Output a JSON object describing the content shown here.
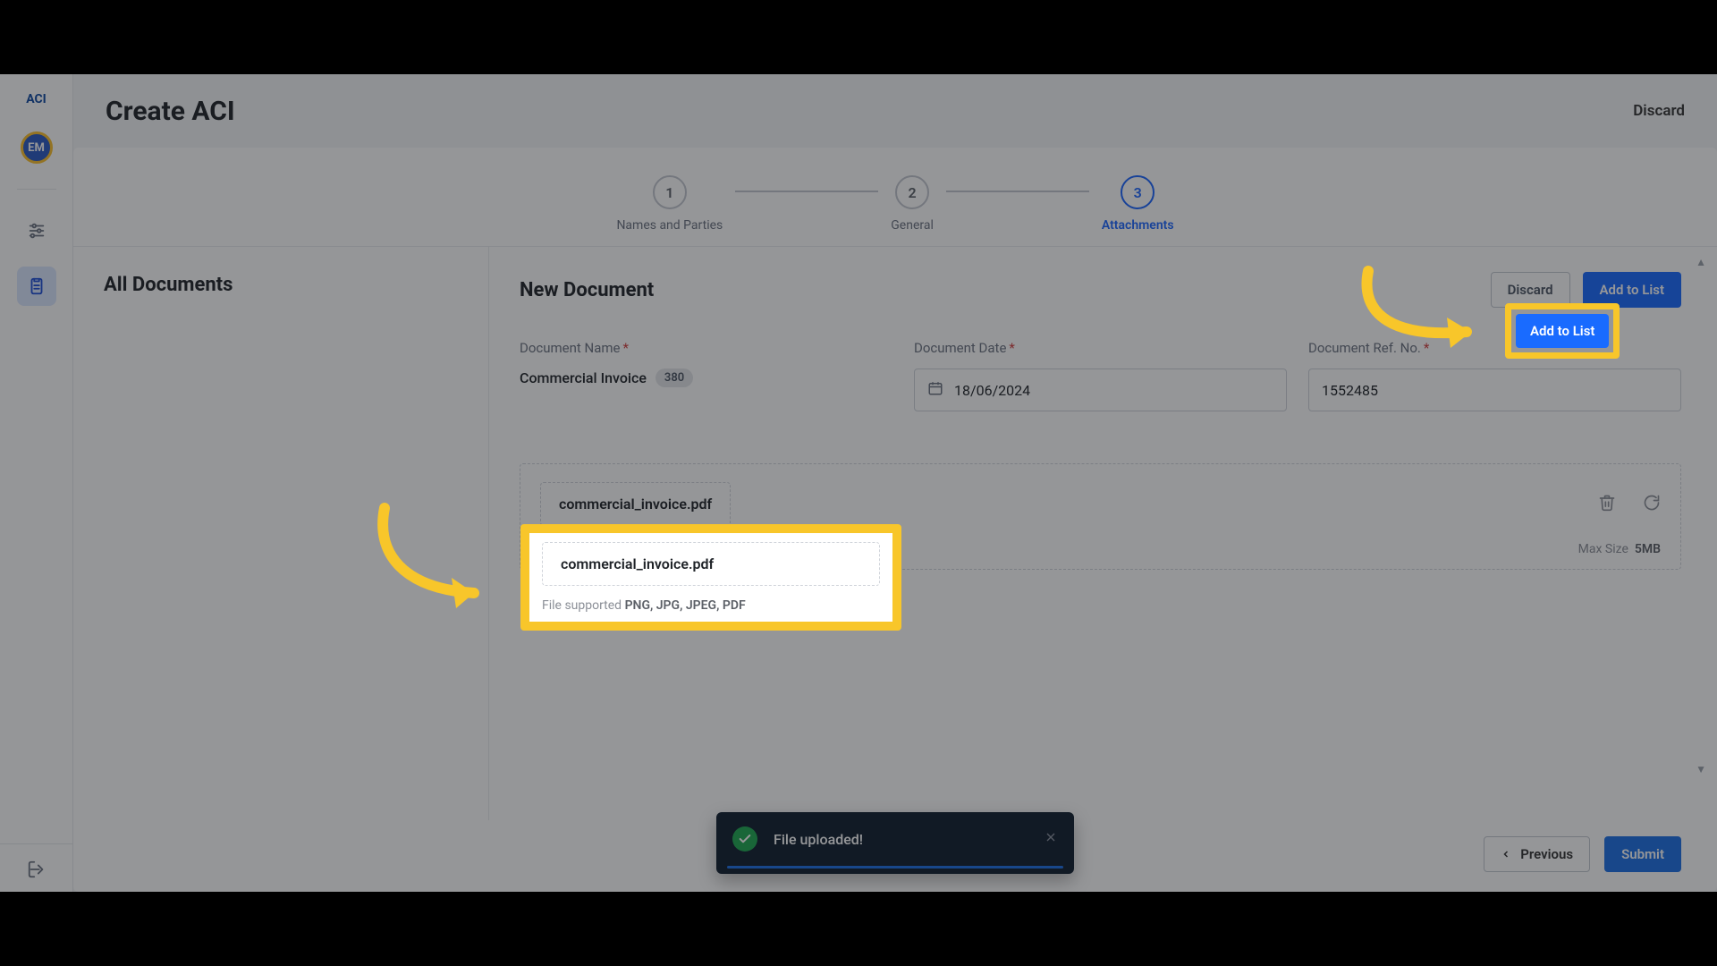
{
  "sidebar": {
    "brand": "ACI",
    "avatar_initials": "EM"
  },
  "header": {
    "title": "Create ACI",
    "discard": "Discard"
  },
  "stepper": {
    "steps": [
      {
        "num": "1",
        "label": "Names and Parties"
      },
      {
        "num": "2",
        "label": "General"
      },
      {
        "num": "3",
        "label": "Attachments"
      }
    ]
  },
  "left": {
    "title": "All Documents"
  },
  "right": {
    "title": "New Document",
    "discard_btn": "Discard",
    "add_btn": "Add to List",
    "fields": {
      "doc_name_label": "Document Name",
      "doc_name_value": "Commercial Invoice",
      "doc_name_badge": "380",
      "doc_date_label": "Document Date",
      "doc_date_value": "18/06/2024",
      "doc_ref_label": "Document Ref. No.",
      "doc_ref_value": "1552485"
    },
    "upload": {
      "file_name": "commercial_invoice.pdf",
      "support_prefix": "File supported ",
      "support_types": "PNG, JPG, JPEG, PDF",
      "max_label": "Max Size",
      "max_size": "5MB"
    }
  },
  "footer": {
    "previous": "Previous",
    "submit": "Submit"
  },
  "toast": {
    "text": "File uploaded!"
  }
}
